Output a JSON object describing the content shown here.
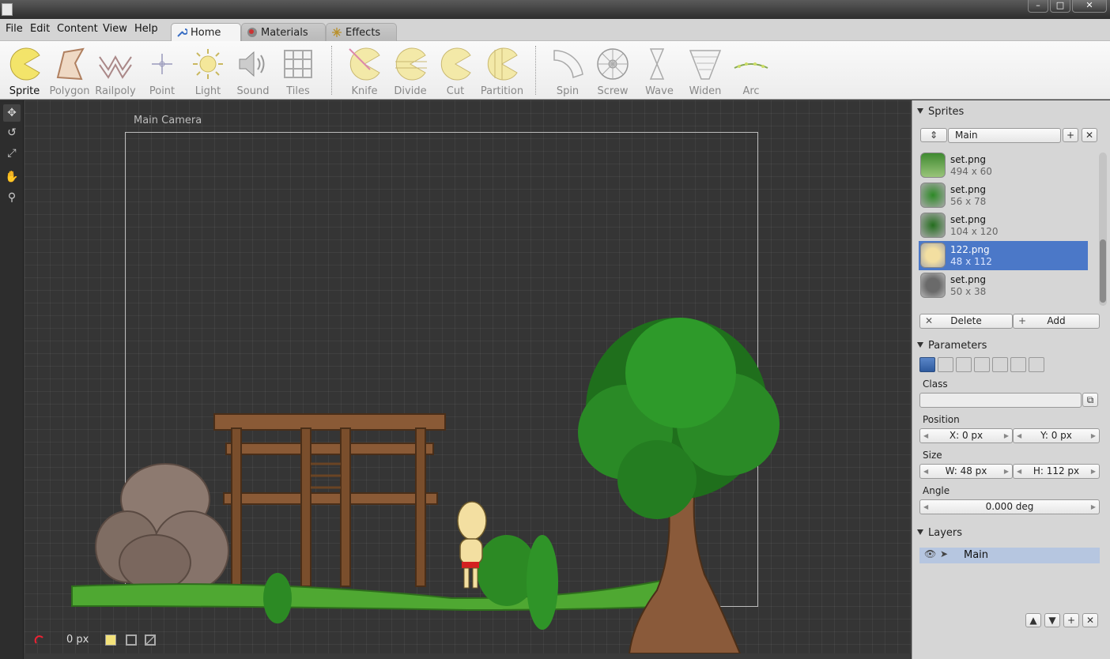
{
  "window": {
    "minimize": "–",
    "maximize": "□",
    "close": "✕"
  },
  "menu": [
    "File",
    "Edit",
    "Content",
    "View",
    "Help"
  ],
  "tabs": [
    {
      "label": "Home",
      "active": true
    },
    {
      "label": "Materials",
      "active": false
    },
    {
      "label": "Effects",
      "active": false
    }
  ],
  "toolbar": {
    "group1": [
      "Sprite",
      "Polygon",
      "Railpoly",
      "Point",
      "Light",
      "Sound",
      "Tiles"
    ],
    "group2": [
      "Knife",
      "Divide",
      "Cut",
      "Partition"
    ],
    "group3": [
      "Spin",
      "Screw",
      "Wave",
      "Widen",
      "Arc"
    ]
  },
  "viewport": {
    "camera_label": "Main Camera"
  },
  "status": {
    "offset": "0 px"
  },
  "sprites": {
    "title": "Sprites",
    "set_name": "Main",
    "items": [
      {
        "name": "set.png",
        "size": "494 x 60"
      },
      {
        "name": "set.png",
        "size": "56 x 78"
      },
      {
        "name": "set.png",
        "size": "104 x 120"
      },
      {
        "name": "122.png",
        "size": "48 x 112",
        "selected": true
      },
      {
        "name": "set.png",
        "size": "50 x 38"
      }
    ],
    "delete_label": "Delete",
    "add_label": "Add"
  },
  "parameters": {
    "title": "Parameters",
    "class_label": "Class",
    "class_value": "",
    "position_label": "Position",
    "pos_x": "X: 0 px",
    "pos_y": "Y: 0 px",
    "size_label": "Size",
    "width": "W: 48 px",
    "height": "H: 112 px",
    "angle_label": "Angle",
    "angle": "0.000 deg"
  },
  "layers": {
    "title": "Layers",
    "items": [
      {
        "name": "Main"
      }
    ]
  },
  "colors": {
    "selection": "#4b78c8",
    "accent_yellow": "#f2e36a"
  }
}
